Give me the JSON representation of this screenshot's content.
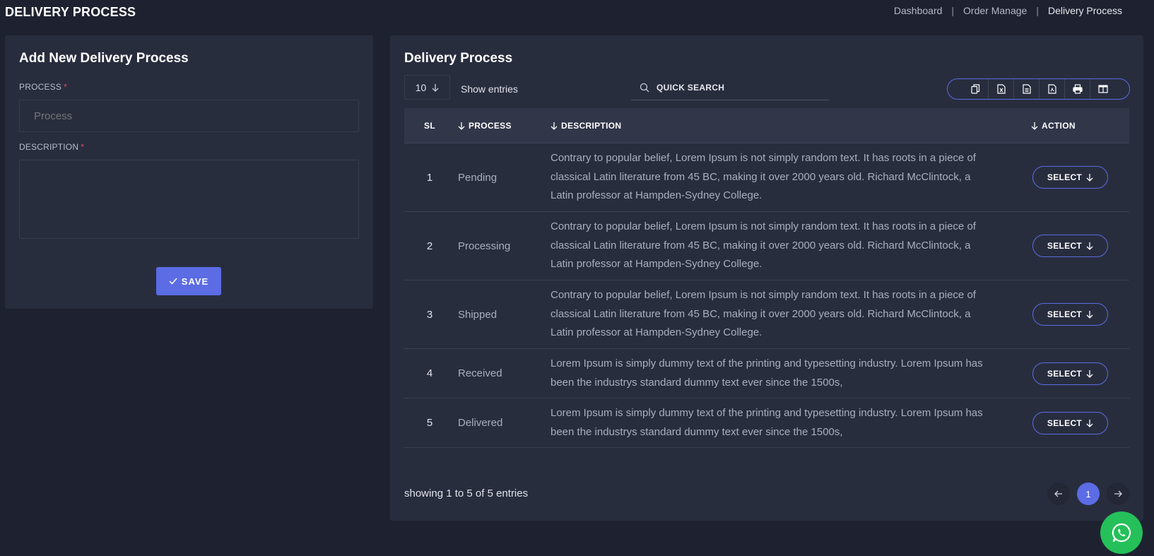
{
  "page": {
    "title": "DELIVERY PROCESS"
  },
  "breadcrumb": [
    "Dashboard",
    "Order Manage",
    "Delivery Process"
  ],
  "form": {
    "title": "Add New Delivery Process",
    "process_label": "PROCESS",
    "process_placeholder": "Process",
    "description_label": "DESCRIPTION",
    "required_mark": "*",
    "save_label": "SAVE"
  },
  "list": {
    "title": "Delivery Process",
    "entries_value": "10",
    "entries_label": "Show entries",
    "search_placeholder": "QUICK SEARCH",
    "columns": [
      "SL",
      "PROCESS",
      "DESCRIPTION",
      "ACTION"
    ],
    "rows": [
      {
        "sl": "1",
        "process": "Pending",
        "description": "Contrary to popular belief, Lorem Ipsum is not simply random text. It has roots in a piece of classical Latin literature from 45 BC, making it over 2000 years old. Richard McClintock, a Latin professor at Hampden-Sydney College.",
        "action": "SELECT"
      },
      {
        "sl": "2",
        "process": "Processing",
        "description": "Contrary to popular belief, Lorem Ipsum is not simply random text. It has roots in a piece of classical Latin literature from 45 BC, making it over 2000 years old. Richard McClintock, a Latin professor at Hampden-Sydney College.",
        "action": "SELECT"
      },
      {
        "sl": "3",
        "process": "Shipped",
        "description": "Contrary to popular belief, Lorem Ipsum is not simply random text. It has roots in a piece of classical Latin literature from 45 BC, making it over 2000 years old. Richard McClintock, a Latin professor at Hampden-Sydney College.",
        "action": "SELECT"
      },
      {
        "sl": "4",
        "process": "Received",
        "description": "Lorem Ipsum is simply dummy text of the printing and typesetting industry. Lorem Ipsum has been the industrys standard dummy text ever since the 1500s,",
        "action": "SELECT"
      },
      {
        "sl": "5",
        "process": "Delivered",
        "description": "Lorem Ipsum is simply dummy text of the printing and typesetting industry. Lorem Ipsum has been the industrys standard dummy text ever since the 1500s,",
        "action": "SELECT"
      }
    ],
    "showing_text": "showing 1 to 5 of 5 entries",
    "current_page": "1"
  },
  "icons": {
    "export": [
      "copy-icon",
      "excel-icon",
      "csv-icon",
      "pdf-icon",
      "print-icon",
      "columns-icon"
    ],
    "floating": "whatsapp-icon"
  },
  "colors": {
    "accent": "#5b6ce4",
    "whatsapp": "#25c05a",
    "required": "#e24d4d"
  }
}
